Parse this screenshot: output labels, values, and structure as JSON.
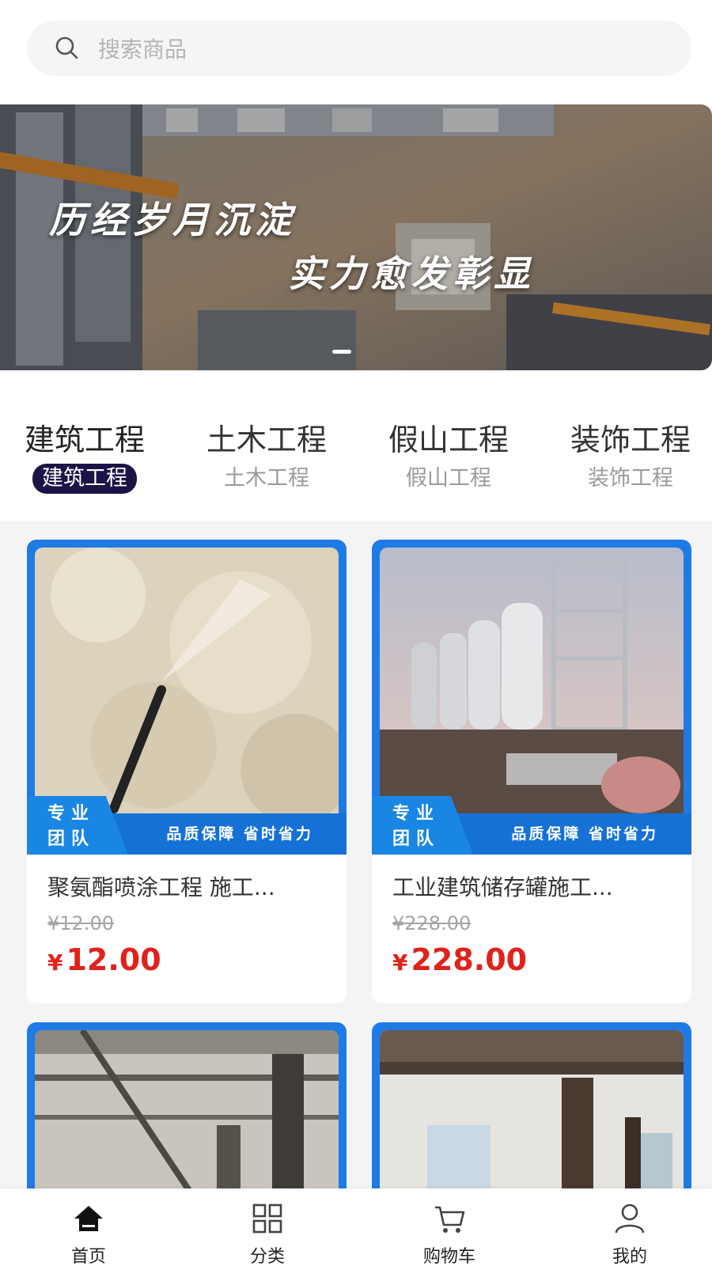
{
  "search": {
    "placeholder": "搜索商品",
    "icon": "search-icon"
  },
  "banner": {
    "line1": "历经岁月沉淀",
    "line2": "实力愈发彰显",
    "active_dot": 1,
    "dot_count": 1
  },
  "categories": [
    {
      "title": "建筑工程",
      "subtitle": "建筑工程",
      "active": true
    },
    {
      "title": "土木工程",
      "subtitle": "土木工程",
      "active": false
    },
    {
      "title": "假山工程",
      "subtitle": "假山工程",
      "active": false
    },
    {
      "title": "装饰工程",
      "subtitle": "装饰工程",
      "active": false
    }
  ],
  "products": [
    {
      "tag_line1": "专业",
      "tag_line2": "团队",
      "slogan": "品质保障 省时省力",
      "title": "聚氨酯喷涂工程 施工...",
      "old_price": "¥12.00",
      "currency": "¥",
      "price": "12.00"
    },
    {
      "tag_line1": "专业",
      "tag_line2": "团队",
      "slogan": "品质保障 省时省力",
      "title": "工业建筑储存罐施工...",
      "old_price": "¥228.00",
      "currency": "¥",
      "price": "228.00"
    },
    {
      "title": ""
    },
    {
      "title": ""
    }
  ],
  "nav": [
    {
      "label": "首页",
      "icon": "home-icon",
      "active": true
    },
    {
      "label": "分类",
      "icon": "grid-icon",
      "active": false
    },
    {
      "label": "购物车",
      "icon": "cart-icon",
      "active": false
    },
    {
      "label": "我的",
      "icon": "user-icon",
      "active": false
    }
  ],
  "colors": {
    "accent_blue": "#1e7be6",
    "price_red": "#e0221b",
    "active_pill": "#1b1446"
  }
}
